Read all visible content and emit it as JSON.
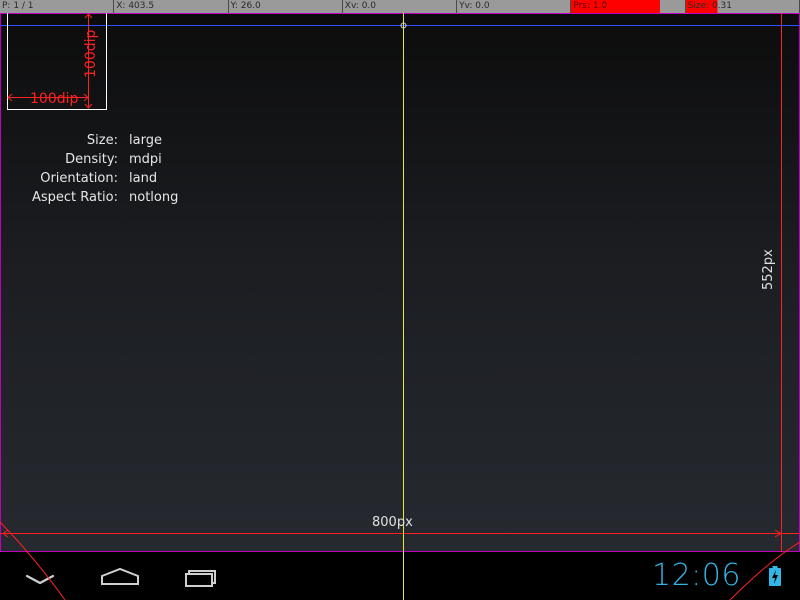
{
  "status_bar": {
    "pointer": "P: 1 / 1",
    "x": "X: 403.5",
    "y": "Y: 26.0",
    "xv": "Xv: 0.0",
    "yv": "Yv: 0.0",
    "pressure": "Prs: 1.0",
    "size": "Size: 0.31"
  },
  "dip_box": {
    "width_label": "100dip",
    "height_label": "100dip"
  },
  "device_info": [
    {
      "key": "Size:",
      "value": "large"
    },
    {
      "key": "Density:",
      "value": "mdpi"
    },
    {
      "key": "Orientation:",
      "value": "land"
    },
    {
      "key": "Aspect Ratio:",
      "value": "notlong"
    }
  ],
  "dimensions": {
    "width_label": "800px",
    "height_label": "552px"
  },
  "clock": {
    "time": "12:06"
  },
  "nav": {
    "back_icon": "chevron-down-icon",
    "home_icon": "home-icon",
    "recents_icon": "recents-icon"
  },
  "colors": {
    "status_bar": "#9a9a9a",
    "pressure_fill": "#ff0000",
    "dip_label": "#ff2222",
    "border_magenta": "#c000c0",
    "crosshair_yellow": "#e6e63c",
    "crosshair_blue": "#3050ff",
    "clock_blue": "#33b5e5"
  }
}
